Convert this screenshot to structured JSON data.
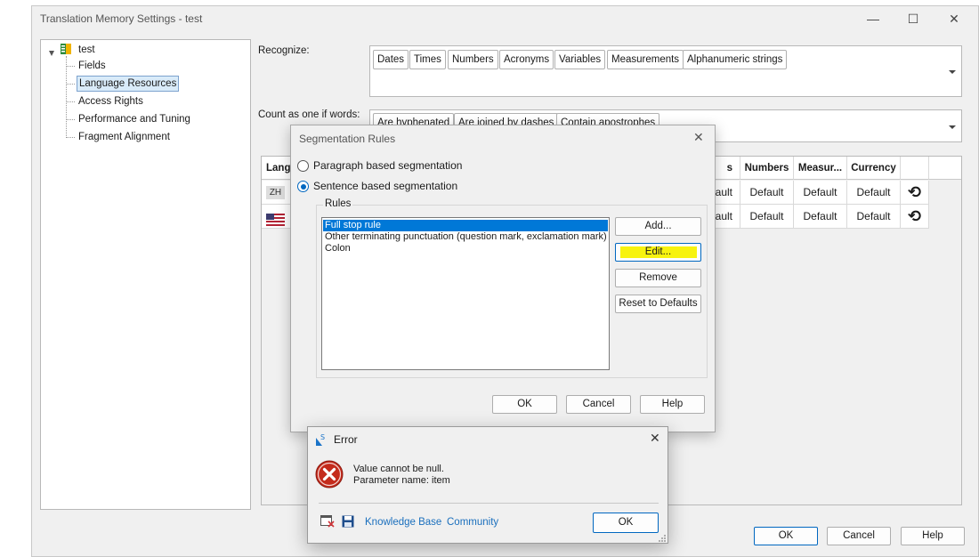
{
  "window": {
    "title": "Translation Memory Settings - test",
    "controls": {
      "minimize": "—",
      "maximize": "☐",
      "close": "✕"
    }
  },
  "tree": {
    "root": "test",
    "items": [
      {
        "label": "Fields",
        "selected": false
      },
      {
        "label": "Language Resources",
        "selected": true
      },
      {
        "label": "Access Rights",
        "selected": false
      },
      {
        "label": "Performance and Tuning",
        "selected": false
      },
      {
        "label": "Fragment Alignment",
        "selected": false
      }
    ]
  },
  "recognize": {
    "label": "Recognize:",
    "tags": [
      "Dates",
      "Times",
      "Numbers",
      "Acronyms",
      "Variables",
      "Measurements",
      "Alphanumeric strings"
    ]
  },
  "count_as_one": {
    "label": "Count as one if words:",
    "tags": [
      "Are hyphenated",
      "Are joined by dashes",
      "Contain apostrophes"
    ]
  },
  "grid": {
    "headers": {
      "language": "Langu",
      "s": "s",
      "numbers": "Numbers",
      "measurements": "Measur...",
      "currency": "Currency"
    },
    "rows": [
      {
        "lang_badge": "ZH",
        "s": "ault",
        "numbers": "Default",
        "measurements": "Default",
        "currency": "Default",
        "action": "⟲"
      },
      {
        "lang_badge": "",
        "s": "ault",
        "numbers": "Default",
        "measurements": "Default",
        "currency": "Default",
        "action": "⟲"
      }
    ]
  },
  "main_buttons": {
    "ok": "OK",
    "cancel": "Cancel",
    "help": "Help"
  },
  "segmentation_dialog": {
    "title": "Segmentation Rules",
    "close": "✕",
    "options": [
      {
        "label": "Paragraph based segmentation",
        "selected": false
      },
      {
        "label": "Sentence based segmentation",
        "selected": true
      }
    ],
    "rules_group_label": "Rules",
    "rules": [
      {
        "label": "Full stop rule",
        "selected": true
      },
      {
        "label": "Other terminating punctuation (question mark, exclamation mark)",
        "selected": false
      },
      {
        "label": "Colon",
        "selected": false
      }
    ],
    "buttons": {
      "add": "Add...",
      "edit": "Edit...",
      "remove": "Remove",
      "reset": "Reset to Defaults"
    },
    "footer": {
      "ok": "OK",
      "cancel": "Cancel",
      "help": "Help"
    },
    "highlight_color": "#f7f30f"
  },
  "error_dialog": {
    "title": "Error",
    "close": "✕",
    "message_line1": "Value cannot be null.",
    "message_line2": "Parameter name: item",
    "links": {
      "knowledge_base": "Knowledge Base",
      "community": "Community"
    },
    "ok": "OK",
    "icon": "error-icon",
    "error_color": "#c42b1c"
  }
}
